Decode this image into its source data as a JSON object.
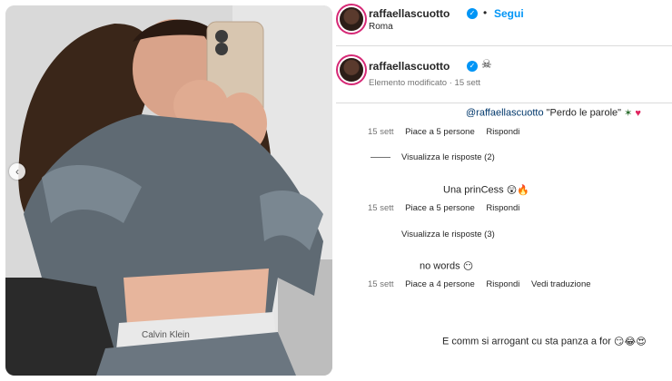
{
  "post": {
    "username": "raffaellascuotto",
    "follow_label": "Segui",
    "separator": "•",
    "location": "Roma"
  },
  "caption": {
    "username": "raffaellascuotto",
    "edited_label": "Elemento modificato",
    "time": "15 sett",
    "separator": "·"
  },
  "comments": [
    {
      "mention": "@raffaellascuotto",
      "text": " \"Perdo le parole\" ",
      "time": "15 sett",
      "likes": "Piace a 5 persone",
      "reply": "Rispondi",
      "view_replies": "Visualizza le risposte (2)"
    },
    {
      "text": "Una prinCess ",
      "time": "15 sett",
      "likes": "Piace a 5 persone",
      "reply": "Rispondi",
      "view_replies": "Visualizza le risposte (3)"
    },
    {
      "text": "no words ",
      "time": "15 sett",
      "likes": "Piace a 4 persone",
      "reply": "Rispondi",
      "translate": "Vedi traduzione"
    },
    {
      "text": "E comm si arrogant cu sta panza a for "
    }
  ],
  "icons": {
    "verified": "verified-badge-icon",
    "carousel_prev": "chevron-left-icon",
    "caption_emoji": "skull-crossbones-emoji",
    "sparkle": "sparkle-emoji",
    "heart": "red-heart-emoji",
    "astonished": "astonished-face-emoji",
    "fire": "fire-emoji",
    "smirk": "grinning-face-emoji",
    "heart_eyes": "heart-eyes-emoji",
    "laughing": "laughing-face-emoji"
  },
  "colors": {
    "accent": "#0095f6",
    "verified": "#0095f6",
    "text": "#262626",
    "secondary": "#737373",
    "mention": "#00376b"
  }
}
